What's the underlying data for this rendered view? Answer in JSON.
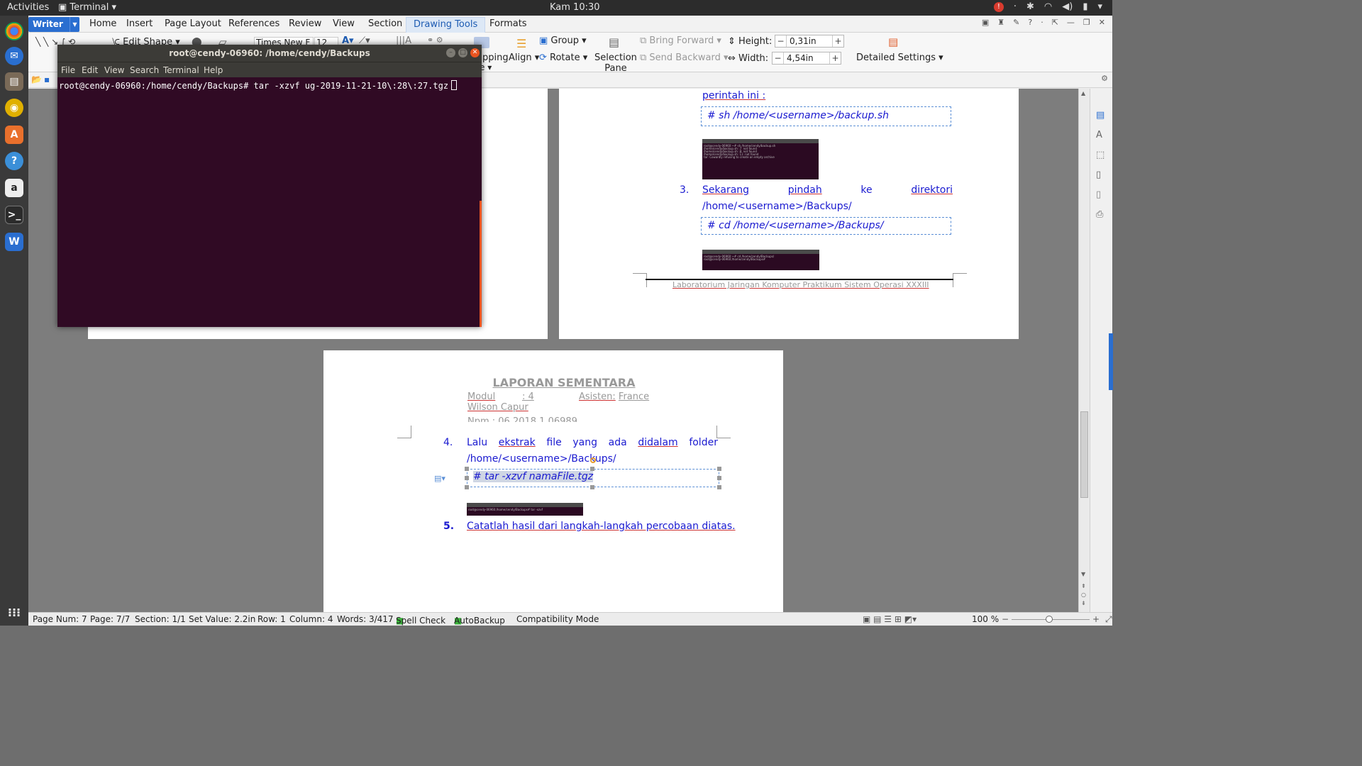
{
  "topbar": {
    "activities": "Activities",
    "app": "Terminal",
    "clock": "Kam 10:30"
  },
  "dock": {
    "items": [
      "chrome-icon",
      "thunderbird-icon",
      "files-icon",
      "rhythmbox-icon",
      "software-center-icon",
      "help-icon",
      "amazon-icon",
      "terminal-icon",
      "wps-writer-icon"
    ],
    "apps_grid": "show-applications-icon"
  },
  "wps": {
    "writer_label": "Writer",
    "menu_tabs": [
      "Home",
      "Insert",
      "Page Layout",
      "References",
      "Review",
      "View",
      "Section",
      "Drawing Tools",
      "Formats"
    ],
    "active_tab": "Drawing Tools",
    "ribbon": {
      "edit_shape": "Edit Shape",
      "font_name": "Times New F",
      "font_size": "12",
      "clipping_line1": "pping",
      "clipping_line2": "e",
      "align": "Align",
      "group": "Group",
      "rotate": "Rotate",
      "selection_pane_1": "Selection",
      "selection_pane_2": "Pane",
      "bring_forward": "Bring Forward",
      "send_backward": "Send Backward",
      "height_label": "Height:",
      "height_value": "0,31in",
      "width_label": "Width:",
      "width_value": "4,54in",
      "detailed_settings": "Detailed Settings"
    }
  },
  "document": {
    "page_top_right": {
      "perintah": "perintah ini :",
      "cmd1": "# sh /home/<username>/backup.sh",
      "step3_num": "3.",
      "step3_words": [
        "Sekarang",
        "pindah",
        "ke",
        "direktori"
      ],
      "step3_line2": "/home/<username>/Backups/",
      "cmd2": "# cd /home/<username>/Backups/",
      "footer": "Laboratorium Jaringan Komputer Praktikum Sistem Operasi XXXIII"
    },
    "page_bottom": {
      "title": "LAPORAN SEMENTARA",
      "modul_label": "Modul",
      "modul_value": ":   4",
      "asisten_label": "Asisten:",
      "asisten_value": "France",
      "asisten_name2": "Wilson Capur",
      "npm": "Npm  : 06  2018  1  06989",
      "step4_num": "4.",
      "step4_words": [
        "Lalu",
        "ekstrak",
        "file",
        "yang",
        "ada",
        "didalam",
        "folder"
      ],
      "step4_line2": "/home/<username>/Backups/",
      "cmd3": "# tar -xzvf namaFile.tgz",
      "step5_num": "5.",
      "step5": "Catatlah hasil dari langkah-langkah percobaan diatas."
    }
  },
  "statusbar": {
    "page_num": "Page Num: 7",
    "page": "Page: 7/7",
    "section": "Section: 1/1",
    "set_value": "Set Value: 2.2in",
    "row": "Row: 1",
    "column": "Column: 4",
    "words": "Words: 3/417",
    "spell_check": "Spell Check",
    "autobackup": "AutoBackup",
    "compat": "Compatibility Mode",
    "zoom": "100 %"
  },
  "terminal": {
    "title": "root@cendy-06960: /home/cendy/Backups",
    "menu": [
      "File",
      "Edit",
      "View",
      "Search",
      "Terminal",
      "Help"
    ],
    "prompt": "root@cendy-06960:/home/cendy/Backups#",
    "command": "tar -xzvf ug-2019-11-21-10\\:28\\:27.tgz"
  }
}
